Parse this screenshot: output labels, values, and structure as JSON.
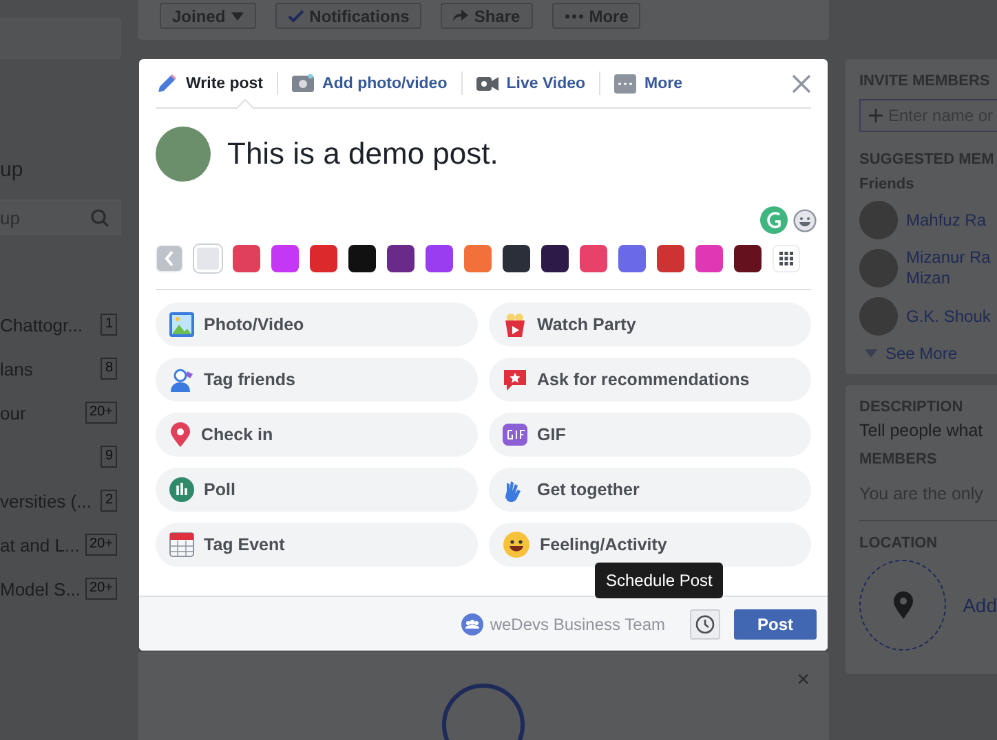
{
  "background": {
    "top_buttons": [
      {
        "label": "Joined",
        "kind": "caret"
      },
      {
        "label": "Notifications",
        "kind": "check"
      },
      {
        "label": "Share",
        "kind": "share"
      },
      {
        "label": "More",
        "kind": "dots"
      }
    ],
    "left": {
      "heading": "up",
      "search": {
        "placeholder": "up"
      },
      "groups": [
        {
          "name": "Chattogr...",
          "count": "1"
        },
        {
          "name": "lans",
          "count": "8"
        },
        {
          "name": "our",
          "count": "20+"
        },
        {
          "count": "9"
        },
        {
          "name": "versities (...",
          "count": "2"
        },
        {
          "name": "at and L...",
          "count": "20+"
        },
        {
          "name": "Model S...",
          "count": "20+"
        }
      ]
    },
    "feed_card_close": "×",
    "right": {
      "invite_heading": "INVITE MEMBERS",
      "invite_field": {
        "placeholder": "Enter name or"
      },
      "suggested_heading": "SUGGESTED MEM",
      "friends_label": "Friends",
      "friends": [
        {
          "name": "Mahfuz Ra"
        },
        {
          "name": "Mizanur Ra\nMizan"
        },
        {
          "name": "G.K. Shouk"
        }
      ],
      "see_more": "See More",
      "description_heading": "DESCRIPTION",
      "description": "Tell people what",
      "members_heading": "MEMBERS",
      "members_text": "You are the only",
      "location_heading": "LOCATION",
      "location_link": "Add"
    }
  },
  "composer": {
    "tabs": [
      {
        "label": "Write post",
        "selected": true
      },
      {
        "label": "Add photo/video",
        "selected": false
      },
      {
        "label": "Live Video",
        "selected": false
      },
      {
        "label": "More",
        "selected": false
      }
    ],
    "text": "This is a demo post.",
    "backgrounds": [
      {
        "color": "#e4e6eb",
        "selected": true
      },
      {
        "color": "#e0405a",
        "selected": false
      },
      {
        "color": "#c337f5",
        "selected": false
      },
      {
        "color": "#dc2a2c",
        "selected": false
      },
      {
        "color": "#111111",
        "selected": false
      },
      {
        "color": "#6a2a8a",
        "selected": false
      },
      {
        "color": "#9a3cf0",
        "selected": false
      },
      {
        "color": "#f2703a",
        "selected": false
      },
      {
        "color": "#2b2f3a",
        "selected": false
      },
      {
        "color": "#2e1a48",
        "selected": false
      },
      {
        "color": "#e8426a",
        "selected": false
      },
      {
        "color": "#6a6ae8",
        "selected": false
      },
      {
        "color": "#cc3333",
        "selected": false
      },
      {
        "color": "#e037b4",
        "selected": false
      },
      {
        "color": "#66121e",
        "selected": false
      }
    ],
    "actions": [
      {
        "label": "Photo/Video"
      },
      {
        "label": "Watch Party"
      },
      {
        "label": "Tag friends"
      },
      {
        "label": "Ask for recommendations"
      },
      {
        "label": "Check in"
      },
      {
        "label": "GIF"
      },
      {
        "label": "Poll"
      },
      {
        "label": "Get together"
      },
      {
        "label": "Tag Event"
      },
      {
        "label": "Feeling/Activity"
      }
    ],
    "group": "weDevs Business Team",
    "tooltip": "Schedule Post",
    "post_button": "Post"
  }
}
